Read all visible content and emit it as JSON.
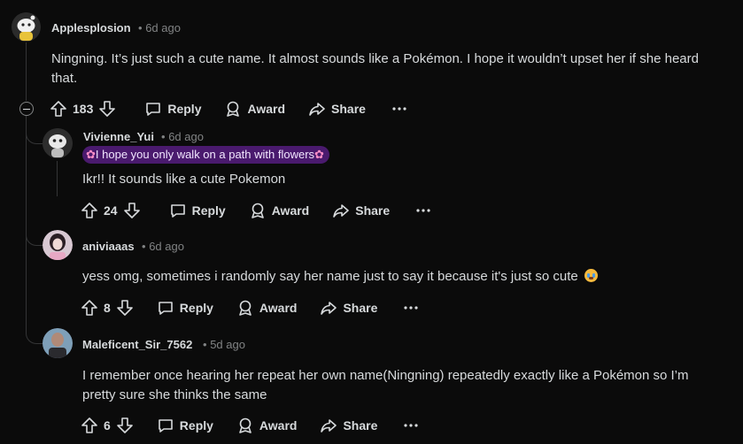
{
  "comments": [
    {
      "author": "Applesplosion",
      "time": "6d ago",
      "body": "Ningning. It’s just such a cute name. It almost sounds like a Pokémon. I hope it wouldn’t upset her if she heard that.",
      "votes": "183"
    },
    {
      "author": "Vivienne_Yui",
      "time": "6d ago",
      "flair": "I hope you only walk on a path with flowers",
      "body": "Ikr!! It sounds like a cute Pokemon",
      "votes": "24"
    },
    {
      "author": "aniviaaas",
      "time": "6d ago",
      "body": "yess omg, sometimes i randomly say her name just to say it because it's just so cute",
      "votes": "8"
    },
    {
      "author": "Maleficent_Sir_7562",
      "time": "5d ago",
      "body": "I remember once hearing her repeat her own name(Ningning) repeatedly exactly like a Pokémon so I’m pretty sure she thinks the same",
      "votes": "6"
    }
  ],
  "labels": {
    "reply": "Reply",
    "award": "Award",
    "share": "Share",
    "dot": "•"
  },
  "colors": {
    "background": "#0b0b0b",
    "text": "#d7dadc",
    "meta": "#818384",
    "flair_bg": "#4a1a6e"
  }
}
